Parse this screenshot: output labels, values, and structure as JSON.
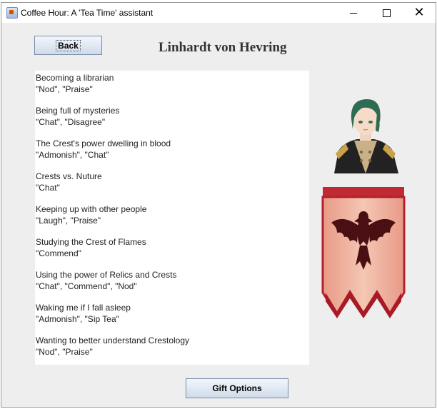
{
  "window": {
    "title": "Coffee Hour: A 'Tea Time' assistant"
  },
  "header": {
    "back_label": "Back",
    "character_name": "Linhardt von Hevring"
  },
  "topics": [
    {
      "topic": "Becoming a librarian",
      "responses": "\"Nod\", \"Praise\""
    },
    {
      "topic": "Being full of mysteries",
      "responses": "\"Chat\", \"Disagree\""
    },
    {
      "topic": "The Crest's power dwelling in blood",
      "responses": "\"Admonish\", \"Chat\""
    },
    {
      "topic": "Crests vs. Nuture",
      "responses": "\"Chat\""
    },
    {
      "topic": "Keeping up with other people",
      "responses": "\"Laugh\", \"Praise\""
    },
    {
      "topic": "Studying the Crest of Flames",
      "responses": "\"Commend\""
    },
    {
      "topic": "Using the power of Relics and Crests",
      "responses": "\"Chat\", \"Commend\", \"Nod\""
    },
    {
      "topic": "Waking me if I fall asleep",
      "responses": "\"Admonish\", \"Sip Tea\""
    },
    {
      "topic": "Wanting to better understand Crestology",
      "responses": "\"Nod\", \"Praise\""
    }
  ],
  "footer": {
    "gift_label": "Gift Options"
  },
  "icons": {
    "app": "java-coffee-icon",
    "minimize": "minimize-icon",
    "maximize": "maximize-icon",
    "close": "close-icon"
  },
  "colors": {
    "window_bg": "#eeeeee",
    "panel_bg": "#ffffff",
    "banner_red": "#b5202c",
    "banner_cream": "#f2e3bf"
  }
}
